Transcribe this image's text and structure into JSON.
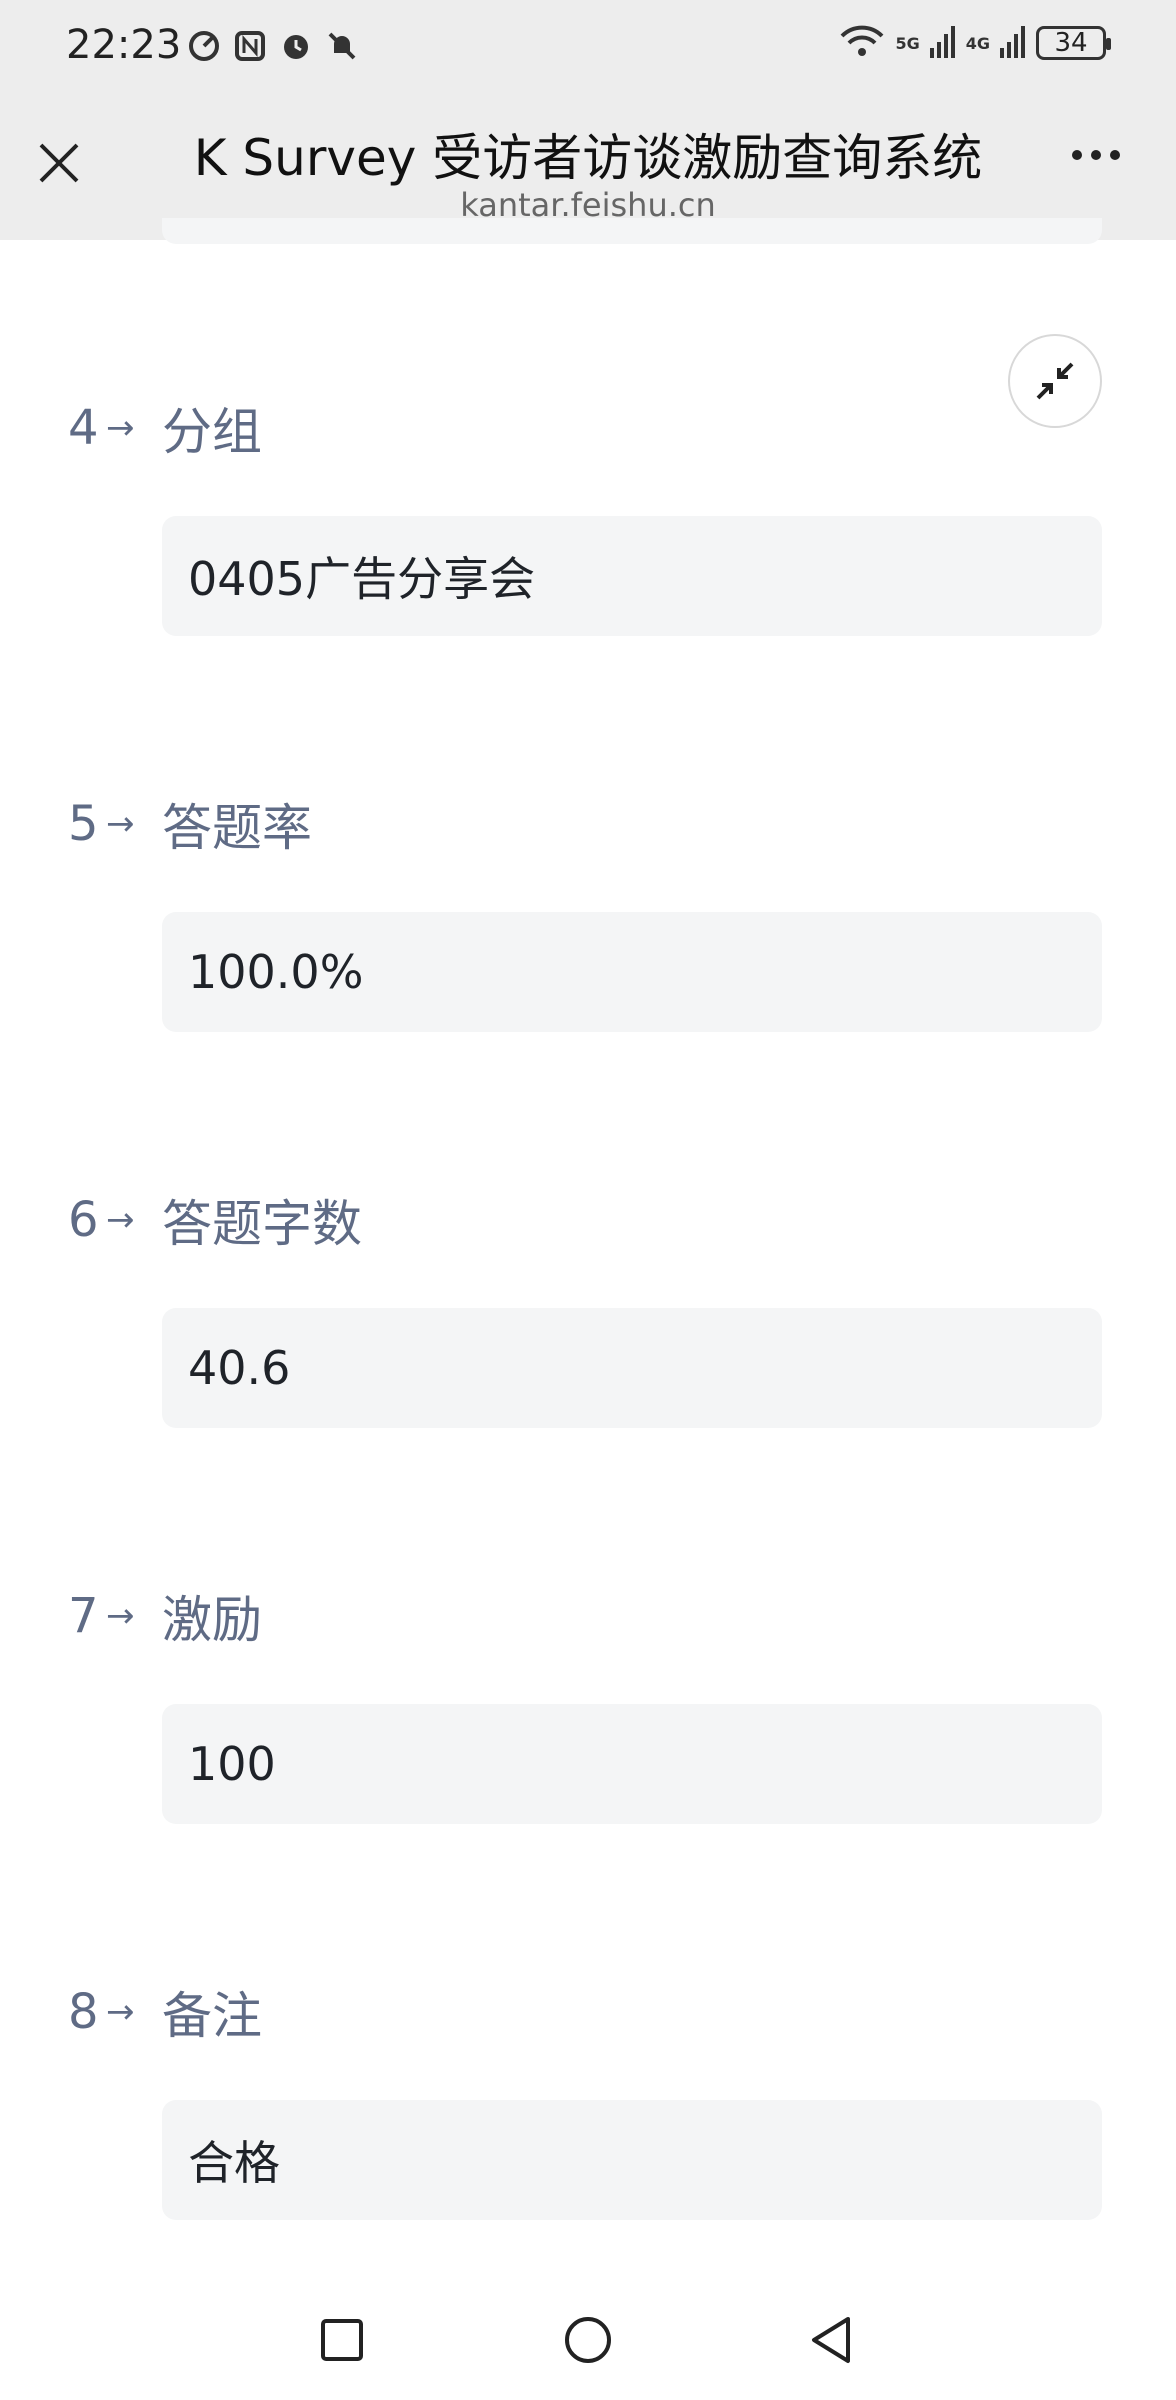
{
  "status_bar": {
    "time": "22:23",
    "battery": "34",
    "net_5g": "5G",
    "net_4g": "4G"
  },
  "header": {
    "title": "K Survey 受访者访谈激励查询系统",
    "url": "kantar.feishu.cn"
  },
  "questions": [
    {
      "num": "4",
      "label": "分组",
      "value": "0405广告分享会"
    },
    {
      "num": "5",
      "label": "答题率",
      "value": "100.0%"
    },
    {
      "num": "6",
      "label": "答题字数",
      "value": "40.6"
    },
    {
      "num": "7",
      "label": "激励",
      "value": "100"
    },
    {
      "num": "8",
      "label": "备注",
      "value": "合格"
    }
  ],
  "arrow_glyph": "→",
  "icons": {
    "close": "close-icon",
    "more": "more-icon",
    "collapse": "collapse-icon",
    "recent": "square-icon",
    "home": "circle-icon",
    "back": "triangle-back-icon"
  }
}
